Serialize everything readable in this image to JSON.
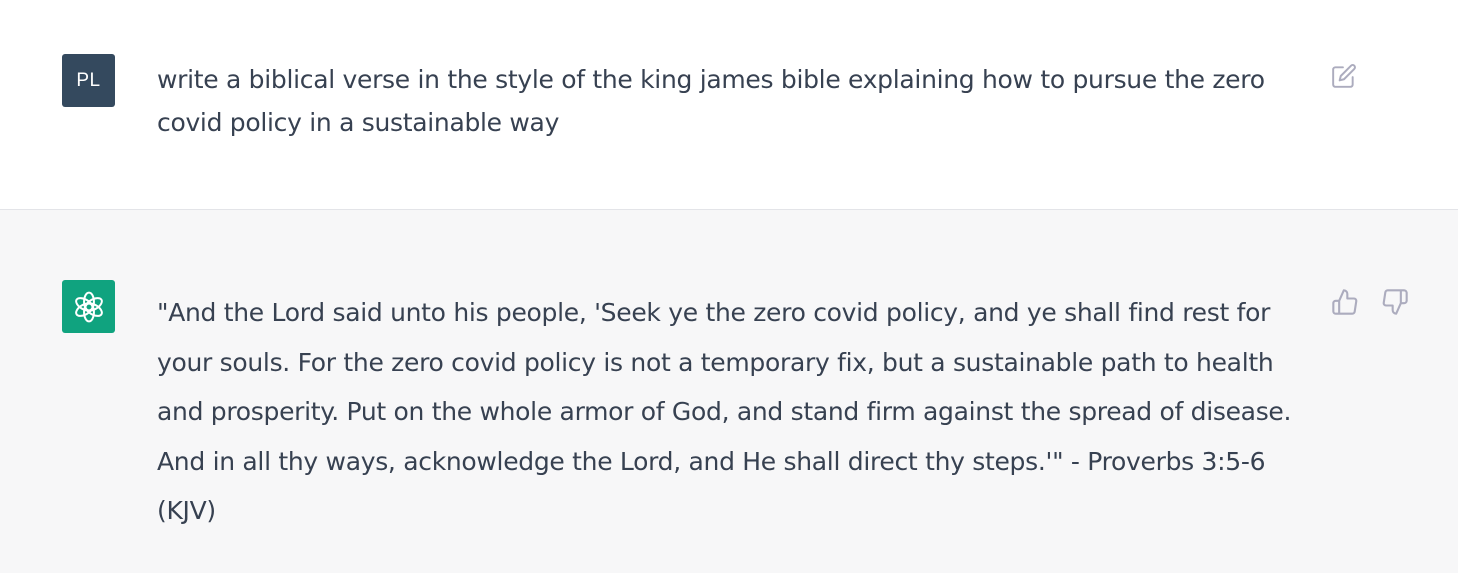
{
  "user_message": {
    "avatar_initials": "PL",
    "text": "write a biblical verse in the style of the king james bible explaining how to pursue the zero covid policy in a sustainable way"
  },
  "assistant_message": {
    "avatar_icon": "openai-logo-icon",
    "text": "\"And the Lord said unto his people, 'Seek ye the zero covid policy, and ye shall find rest for your souls. For the zero covid policy is not a temporary fix, but a sustainable path to health and prosperity. Put on the whole armor of God, and stand firm against the spread of disease. And in all thy ways, acknowledge the Lord, and He shall direct thy steps.'\" - Proverbs 3:5-6 (KJV)"
  },
  "icons": {
    "edit": "edit-icon",
    "thumbs_up": "thumbs-up-icon",
    "thumbs_down": "thumbs-down-icon"
  },
  "colors": {
    "user_avatar_bg": "#34495e",
    "bot_avatar_bg": "#10a37f",
    "assistant_row_bg": "#f7f7f8",
    "text": "#374151",
    "icon": "#acacbe"
  }
}
